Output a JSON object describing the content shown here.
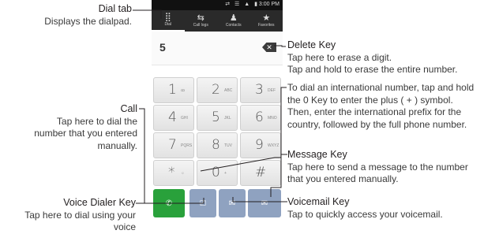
{
  "phone": {
    "status": {
      "icons": "⇄ ☰ ▲ ▮",
      "time": "3:00 PM"
    },
    "tabs": [
      {
        "icon": "⣿",
        "label": "Dial"
      },
      {
        "icon": "⇆",
        "label": "Call logs"
      },
      {
        "icon": "♟",
        "label": "Contacts"
      },
      {
        "icon": "★",
        "label": "Favorites"
      }
    ],
    "entered_number": "5",
    "delete_glyph": "✕",
    "keys": [
      {
        "digit": "1",
        "letters": "ꝏ"
      },
      {
        "digit": "2",
        "letters": "ABC"
      },
      {
        "digit": "3",
        "letters": "DEF"
      },
      {
        "digit": "4",
        "letters": "GHI"
      },
      {
        "digit": "5",
        "letters": "JKL"
      },
      {
        "digit": "6",
        "letters": "MNO"
      },
      {
        "digit": "7",
        "letters": "PQRS"
      },
      {
        "digit": "8",
        "letters": "TUV"
      },
      {
        "digit": "9",
        "letters": "WXYZ"
      },
      {
        "digit": "*",
        "letters": "☼"
      },
      {
        "digit": "0",
        "letters": "+"
      },
      {
        "digit": "#",
        "letters": ""
      }
    ],
    "bottom": {
      "call": "✆",
      "voice_dialer": "⎚",
      "voicemail": "✉",
      "message": "✉"
    }
  },
  "annotations": {
    "dial_tab": {
      "title": "Dial tab",
      "desc": "Displays the dialpad."
    },
    "delete_key": {
      "title": "Delete Key",
      "lines": [
        "Tap here to erase a digit.",
        "Tap and hold to erase the entire number."
      ]
    },
    "international": {
      "lines": [
        "To dial an international number, tap and hold",
        "the 0 Key to enter the plus ( + ) symbol.",
        "Then, enter the international prefix for the",
        "country, followed by the full phone number."
      ]
    },
    "call": {
      "title": "Call",
      "lines": [
        "Tap here to dial the",
        "number that you entered",
        "manually."
      ]
    },
    "message_key": {
      "title": "Message Key",
      "lines": [
        "Tap here to send a message to the number",
        "that you entered manually."
      ]
    },
    "voice_dialer": {
      "title": "Voice Dialer Key",
      "lines": [
        "Tap here to dial using your",
        "voice"
      ]
    },
    "voicemail": {
      "title": "Voicemail Key",
      "lines": [
        "Tap to quickly access your voicemail."
      ]
    }
  }
}
